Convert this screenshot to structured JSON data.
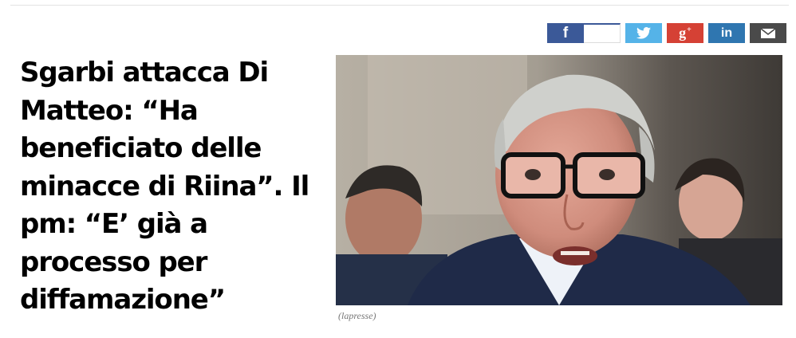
{
  "share": {
    "facebook_icon": "facebook-icon",
    "facebook_count": "",
    "twitter_icon": "twitter-bird-icon",
    "googleplus_icon": "google-plus-icon",
    "linkedin_icon": "linkedin-icon",
    "email_icon": "envelope-icon",
    "colors": {
      "facebook": "#3b5998",
      "twitter": "#55b3e8",
      "googleplus": "#d54135",
      "linkedin": "#2f76b0",
      "email": "#4a4a4a"
    },
    "labels": {
      "facebook": "f",
      "googleplus": "g",
      "googleplus_sup": "+",
      "linkedin": "in"
    }
  },
  "article": {
    "headline": "Sgarbi attacca Di Matteo: “Ha beneficiato delle minacce di Riina”. Il pm: “E’ già a processo per diffamazione”",
    "image_caption": "(lapresse)"
  }
}
